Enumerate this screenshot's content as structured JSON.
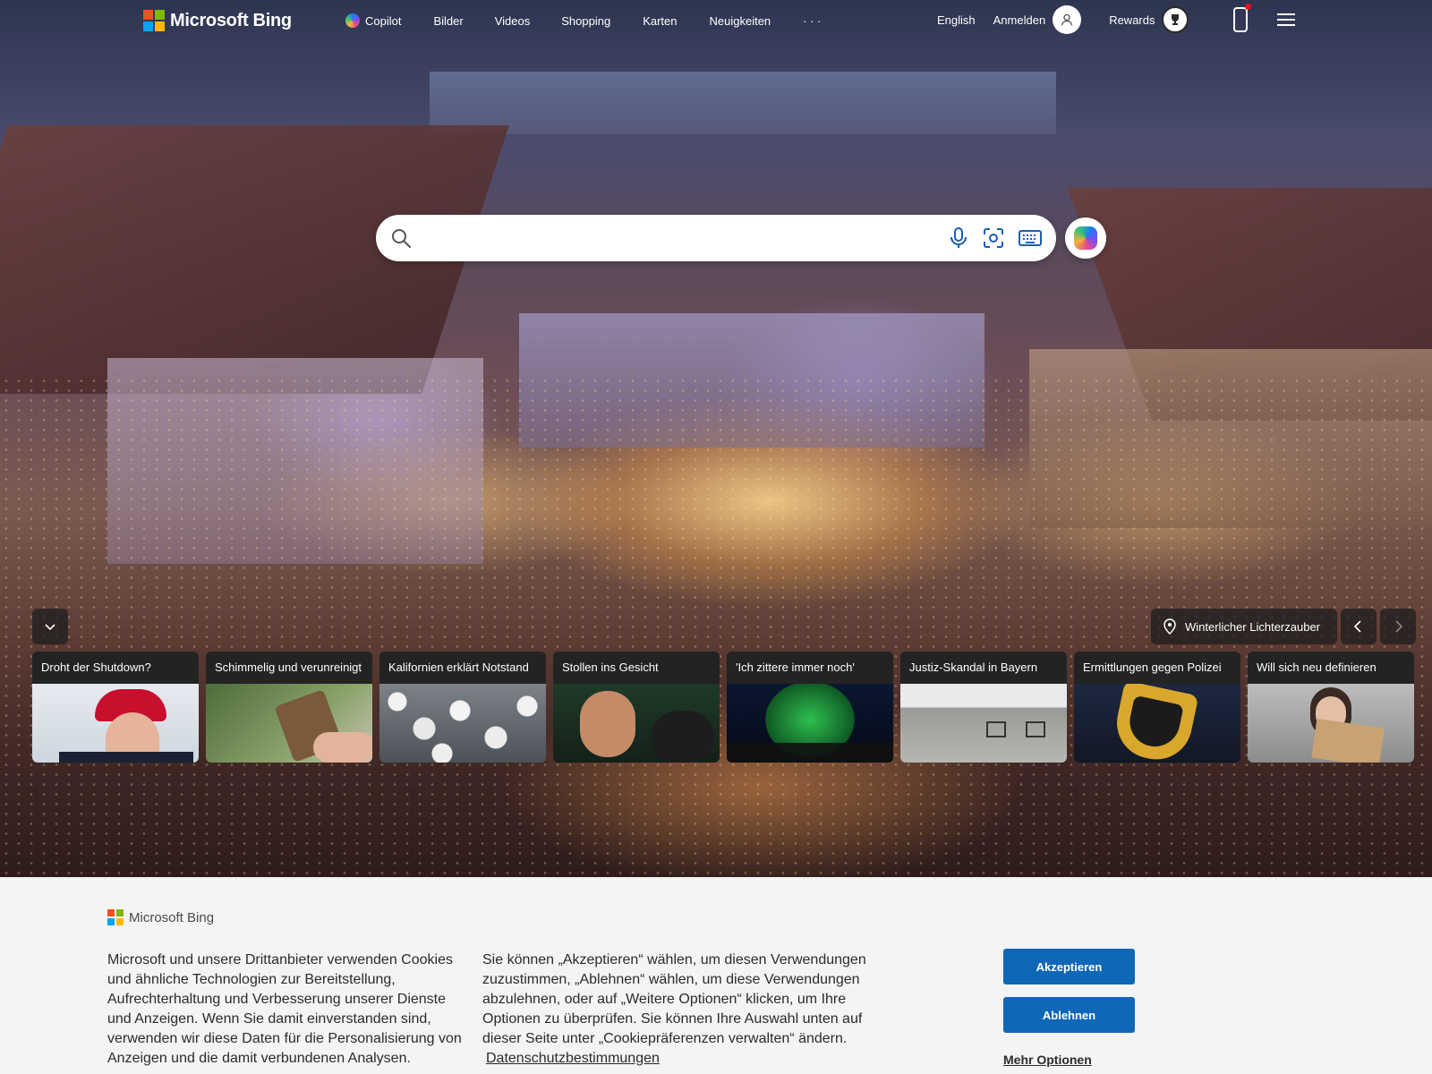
{
  "brand": {
    "name": "Microsoft Bing",
    "logo_colors": [
      "#f25022",
      "#7fba00",
      "#00a4ef",
      "#ffb900"
    ]
  },
  "nav": {
    "items": [
      {
        "label": "Copilot",
        "icon": "copilot-icon"
      },
      {
        "label": "Bilder"
      },
      {
        "label": "Videos"
      },
      {
        "label": "Shopping"
      },
      {
        "label": "Karten"
      },
      {
        "label": "Neuigkeiten"
      },
      {
        "label": "· · ·"
      }
    ]
  },
  "header_right": {
    "language": "English",
    "sign_in": "Anmelden",
    "rewards": "Rewards",
    "icons": [
      "user-avatar-icon",
      "rewards-trophy-icon",
      "mobile-phone-icon",
      "hamburger-menu-icon"
    ]
  },
  "search": {
    "placeholder": "",
    "icons": [
      "search-icon",
      "microphone-icon",
      "visual-search-icon",
      "keyboard-icon",
      "copilot-icon"
    ]
  },
  "carousel": {
    "location_label": "Winterlicher Lichterzauber",
    "cards": [
      {
        "title": "Droht der Shutdown?"
      },
      {
        "title": "Schimmelig und verunreinigt"
      },
      {
        "title": "Kalifornien erklärt Notstand"
      },
      {
        "title": "Stollen ins Gesicht"
      },
      {
        "title": "'Ich zittere immer noch'"
      },
      {
        "title": "Justiz-Skandal in Bayern"
      },
      {
        "title": "Ermittlungen gegen Polizei"
      },
      {
        "title": "Will sich neu definieren"
      }
    ]
  },
  "cookie": {
    "brand": "Microsoft Bing",
    "text_left": "Microsoft und unsere Drittanbieter verwenden Cookies und ähnliche Technologien zur Bereitstellung, Aufrechterhaltung und Verbesserung unserer Dienste und Anzeigen. Wenn Sie damit einverstanden sind, verwenden wir diese Daten für die Personalisierung von Anzeigen und die damit verbundenen Analysen.",
    "text_right": "Sie können „Akzeptieren“ wählen, um diesen Verwendungen zuzustimmen, „Ablehnen“ wählen, um diese Verwendungen abzulehnen, oder auf „Weitere Optionen“ klicken, um Ihre Optionen zu überprüfen. Sie können Ihre Auswahl unten auf dieser Seite unter „Cookiepräferenzen verwalten“ ändern.",
    "privacy_link": "Datenschutzbestimmungen",
    "accept": "Akzeptieren",
    "reject": "Ablehnen",
    "more": "Mehr Optionen"
  },
  "colors": {
    "primary_button": "#0f67b8",
    "cookie_bg": "#f4f4f4",
    "card_title_bg": "#232323"
  }
}
